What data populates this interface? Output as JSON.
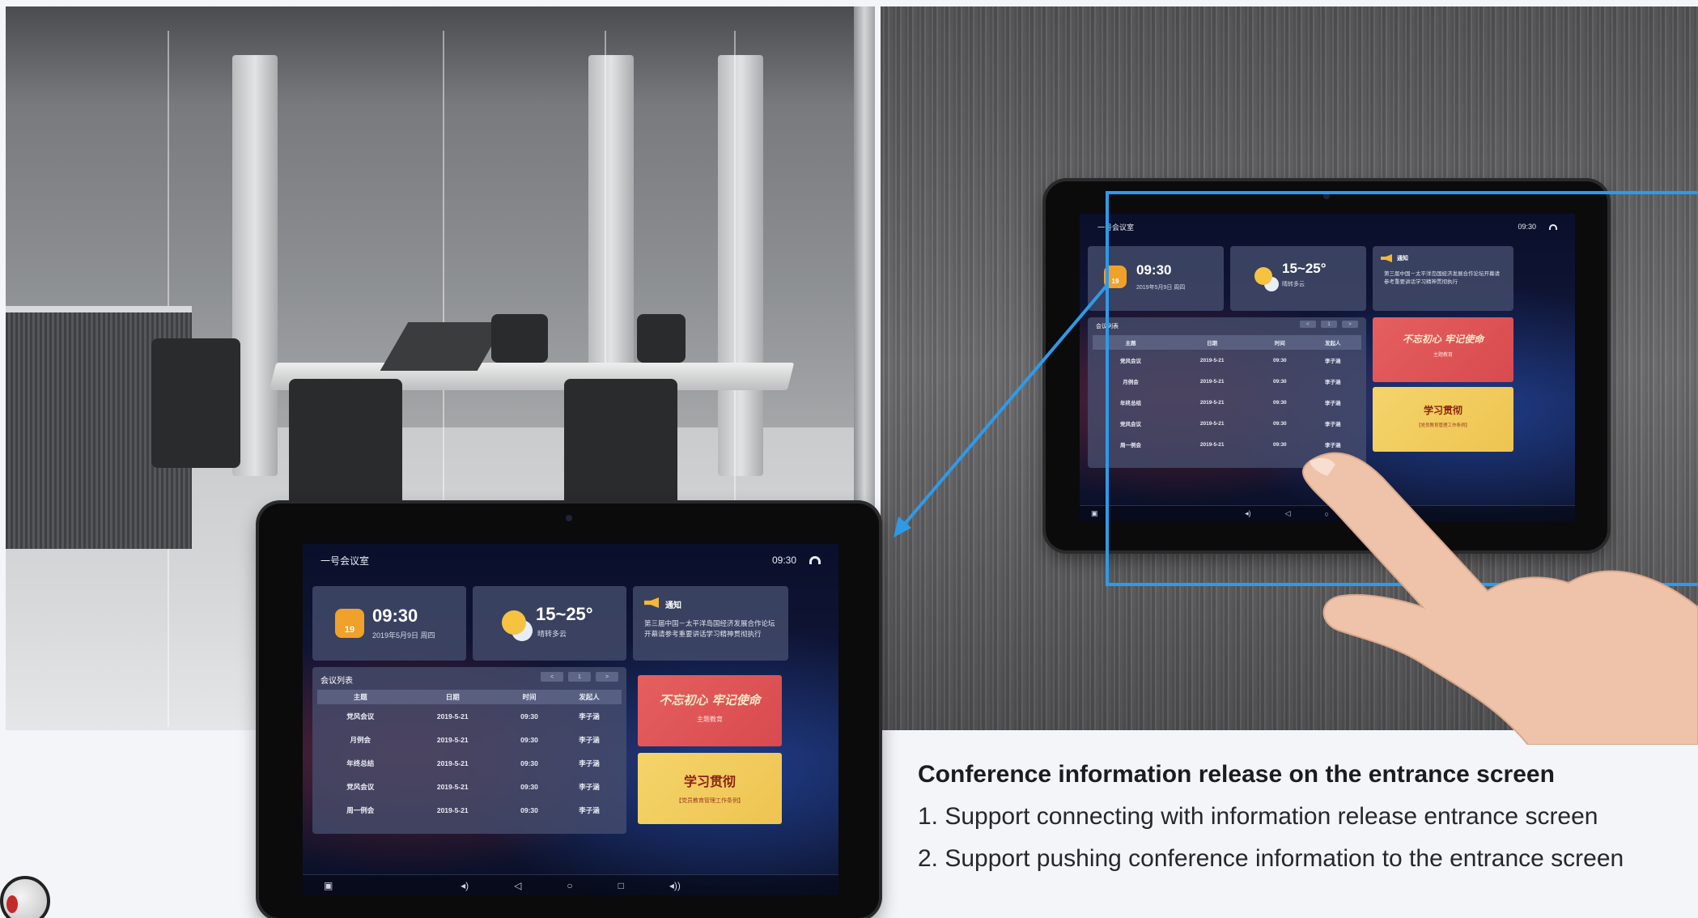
{
  "screen": {
    "room_name": "一号会议室",
    "status_time": "09:30",
    "time_card": {
      "calendar_day": "19",
      "clock": "09:30",
      "date_line": "2019年5月9日 周四"
    },
    "weather_card": {
      "temperature": "15~25°",
      "condition": "晴转多云"
    },
    "notice_card": {
      "title": "通知",
      "body": "第三届中国－太平洋岛国经济发展合作论坛开幕请参考重要讲话学习精神贯彻执行"
    },
    "meeting_list": {
      "title": "会议列表",
      "pager": [
        "<",
        "1",
        ">"
      ],
      "headers": [
        "主题",
        "日期",
        "时间",
        "发起人"
      ],
      "rows": [
        [
          "党风会议",
          "2019-5-21",
          "09:30",
          "李子涵"
        ],
        [
          "月例会",
          "2019-5-21",
          "09:30",
          "李子涵"
        ],
        [
          "年终总结",
          "2019-5-21",
          "09:30",
          "李子涵"
        ],
        [
          "党风会议",
          "2019-5-21",
          "09:30",
          "李子涵"
        ],
        [
          "周一例会",
          "2019-5-21",
          "09:30",
          "李子涵"
        ]
      ]
    },
    "banner_red": {
      "headline": "不忘初心 牢记使命",
      "sub": "主题教育"
    },
    "banner_yellow": {
      "headline": "学习贯彻",
      "sub": "【党员教育管理工作条例】"
    },
    "navbar_icons": [
      "screenshot-icon",
      "volume-down-icon",
      "back-icon",
      "home-icon",
      "recents-icon",
      "volume-up-icon"
    ]
  },
  "caption": {
    "heading": "Conference information release on the entrance screen",
    "points": [
      "1. Support connecting with information release entrance screen",
      "2. Support pushing conference information to the entrance screen"
    ]
  },
  "colors": {
    "callout_blue": "#2f9ae8",
    "page_bg": "#f3f5f8",
    "calendar_orange": "#f0a12a"
  }
}
